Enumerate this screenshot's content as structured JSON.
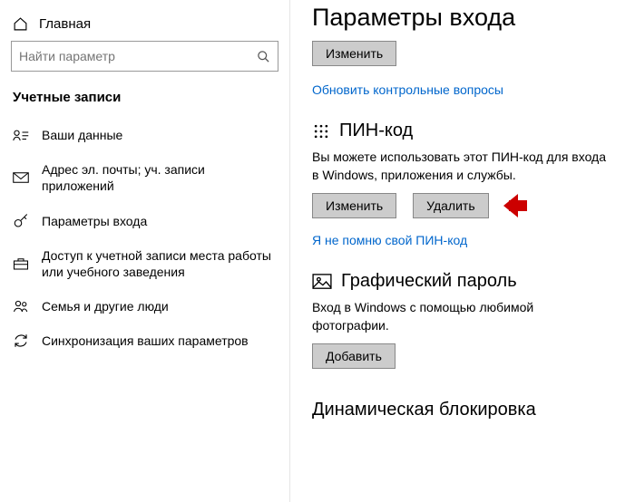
{
  "sidebar": {
    "home": "Главная",
    "search_placeholder": "Найти параметр",
    "category": "Учетные записи",
    "items": [
      {
        "label": "Ваши данные"
      },
      {
        "label": "Адрес эл. почты; уч. записи приложений"
      },
      {
        "label": "Параметры входа"
      },
      {
        "label": "Доступ к учетной записи места работы или учебного заведения"
      },
      {
        "label": "Семья и другие люди"
      },
      {
        "label": "Синхронизация ваших параметров"
      }
    ]
  },
  "main": {
    "title": "Параметры входа",
    "top_button": "Изменить",
    "update_questions_link": "Обновить контрольные вопросы",
    "pin": {
      "heading": "ПИН-код",
      "desc": "Вы можете использовать этот ПИН-код для входа в Windows, приложения и службы.",
      "change": "Изменить",
      "remove": "Удалить",
      "forgot_link": "Я не помню свой ПИН-код"
    },
    "picture": {
      "heading": "Графический пароль",
      "desc": "Вход в Windows с помощью любимой фотографии.",
      "add": "Добавить"
    },
    "dynamic_lock": "Динамическая блокировка"
  }
}
